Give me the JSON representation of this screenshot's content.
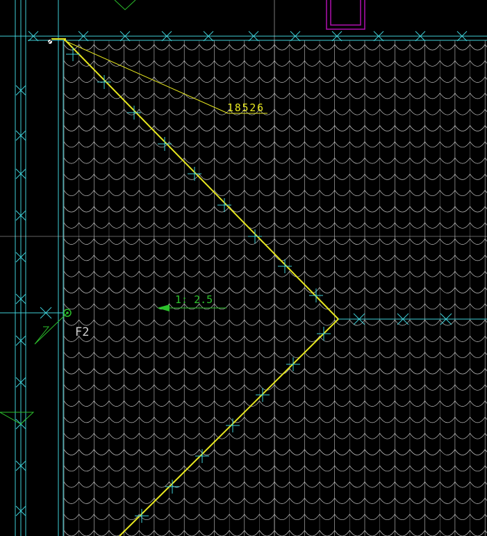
{
  "drawing": {
    "background": "#000000",
    "colors": {
      "cyan": "#3fd0d8",
      "grid": "#c8c8c8",
      "yellow": "#e8e820",
      "green": "#2cc12c",
      "magenta": "#b010b0"
    },
    "icons": [
      "x-marker-icon",
      "circle-marker-icon",
      "arrow-icon",
      "triangle-marker-icon"
    ]
  },
  "labels": {
    "dimension": "18526",
    "slope": "1: 2.5",
    "slope_arrow": "←",
    "roof_code": "F2"
  }
}
